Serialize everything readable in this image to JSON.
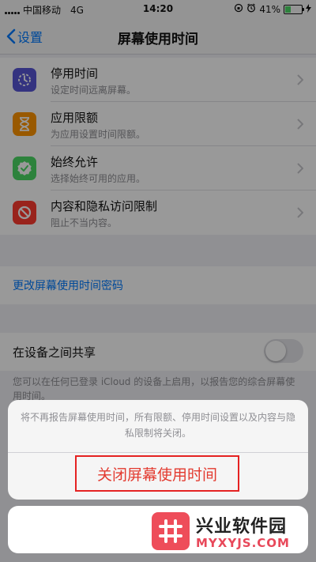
{
  "status_bar": {
    "carrier": "中国移动",
    "network": "4G",
    "time": "14:20",
    "battery_percent": "41%",
    "battery_level": 0.41,
    "icons": [
      "signal-icon",
      "orientation-lock-icon",
      "alarm-icon",
      "battery-icon",
      "charging-icon"
    ]
  },
  "nav": {
    "back_label": "设置",
    "title": "屏幕使用时间"
  },
  "menu": {
    "items": [
      {
        "title": "停用时间",
        "subtitle": "设定时间远离屏幕。",
        "icon": "downtime-icon",
        "color": "#5856d6"
      },
      {
        "title": "应用限额",
        "subtitle": "为应用设置时间限额。",
        "icon": "hourglass-icon",
        "color": "#ff9500"
      },
      {
        "title": "始终允许",
        "subtitle": "选择始终可用的应用。",
        "icon": "checkmark-badge-icon",
        "color": "#4cd964"
      },
      {
        "title": "内容和隐私访问限制",
        "subtitle": "阻止不当内容。",
        "icon": "restriction-icon",
        "color": "#ff3b30"
      }
    ]
  },
  "passcode_link": "更改屏幕使用时间密码",
  "share": {
    "label": "在设备之间共享",
    "enabled": false,
    "footnote": "您可以在任何已登录 iCloud 的设备上启用，以报告您的综合屏幕使用时间。"
  },
  "action_sheet": {
    "message": "将不再报告屏幕使用时间，所有限额、停用时间设置以及内容与隐私限制将关闭。",
    "destructive_label": "关闭屏幕使用时间",
    "destructive_color": "#e33a2f"
  },
  "watermark": {
    "title": "兴业软件园",
    "subtitle": "MYXYJS.COM"
  },
  "colors": {
    "accent": "#007aff",
    "highlight_border": "#e52222"
  }
}
